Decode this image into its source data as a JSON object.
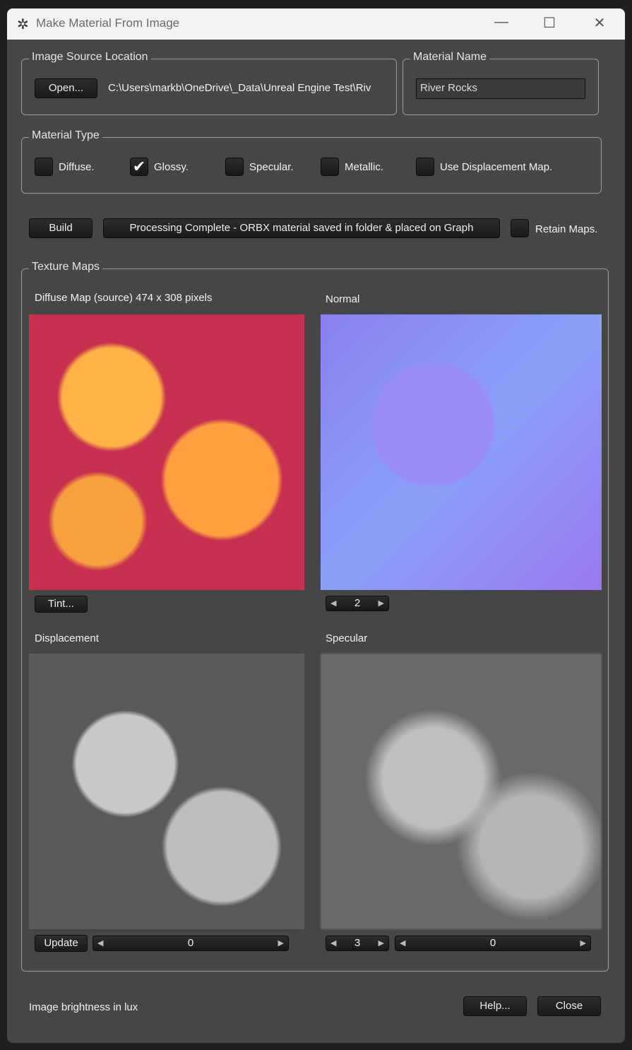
{
  "window": {
    "title": "Make Material From Image",
    "minimize": "—",
    "maximize": "☐",
    "close": "✕"
  },
  "source": {
    "legend": "Image Source Location",
    "open_label": "Open...",
    "path": "C:\\Users\\markb\\OneDrive\\_Data\\Unreal Engine Test\\Riv"
  },
  "name": {
    "legend": "Material Name",
    "value": "River Rocks"
  },
  "type": {
    "legend": "Material Type",
    "options": [
      {
        "label": "Diffuse.",
        "checked": false
      },
      {
        "label": "Glossy.",
        "checked": true
      },
      {
        "label": "Specular.",
        "checked": false
      },
      {
        "label": "Metallic.",
        "checked": false
      },
      {
        "label": "Use Displacement Map.",
        "checked": false
      }
    ],
    "check_glyph": "✔"
  },
  "build": {
    "label": "Build",
    "status": "Processing Complete - ORBX material saved in folder & placed on Graph",
    "retain_label": "Retain Maps.",
    "retain_checked": false
  },
  "maps": {
    "legend": "Texture Maps",
    "diffuse": {
      "label": "Diffuse Map (source) 474 x 308 pixels",
      "tint_label": "Tint..."
    },
    "normal": {
      "label": "Normal",
      "spin_value": "2"
    },
    "displacement": {
      "label": "Displacement",
      "update_label": "Update",
      "slider_value": "0"
    },
    "specular": {
      "label": "Specular",
      "spin_value": "3",
      "slider_value": "0"
    }
  },
  "footer": {
    "status": "Image brightness in lux",
    "help_label": "Help...",
    "close_label": "Close"
  }
}
